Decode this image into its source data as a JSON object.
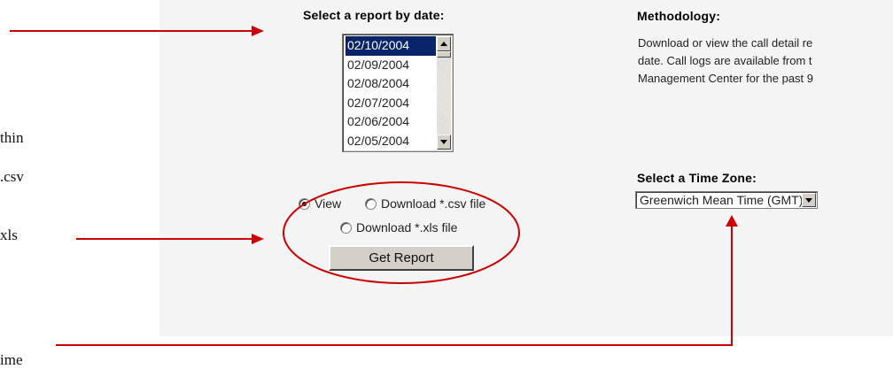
{
  "left_fragments": [
    "thin",
    ".csv",
    "xls",
    "ime"
  ],
  "date_section": {
    "heading": "Select a report by date:",
    "dates": [
      "02/10/2004",
      "02/09/2004",
      "02/08/2004",
      "02/07/2004",
      "02/06/2004",
      "02/05/2004"
    ],
    "selected": "02/10/2004"
  },
  "output_options": {
    "view_label": "View",
    "csv_label": "Download *.csv file",
    "xls_label": "Download *.xls file",
    "selected": "View"
  },
  "get_report_label": "Get Report",
  "methodology": {
    "heading": "Methodology:",
    "lines": [
      "Download or view the call detail re",
      "date. Call logs are available from t",
      "Management Center for the past 9"
    ]
  },
  "time_zone": {
    "heading": "Select a Time Zone:",
    "selected": "Greenwich Mean Time (GMT)"
  },
  "annotation_color": "#cc0000"
}
